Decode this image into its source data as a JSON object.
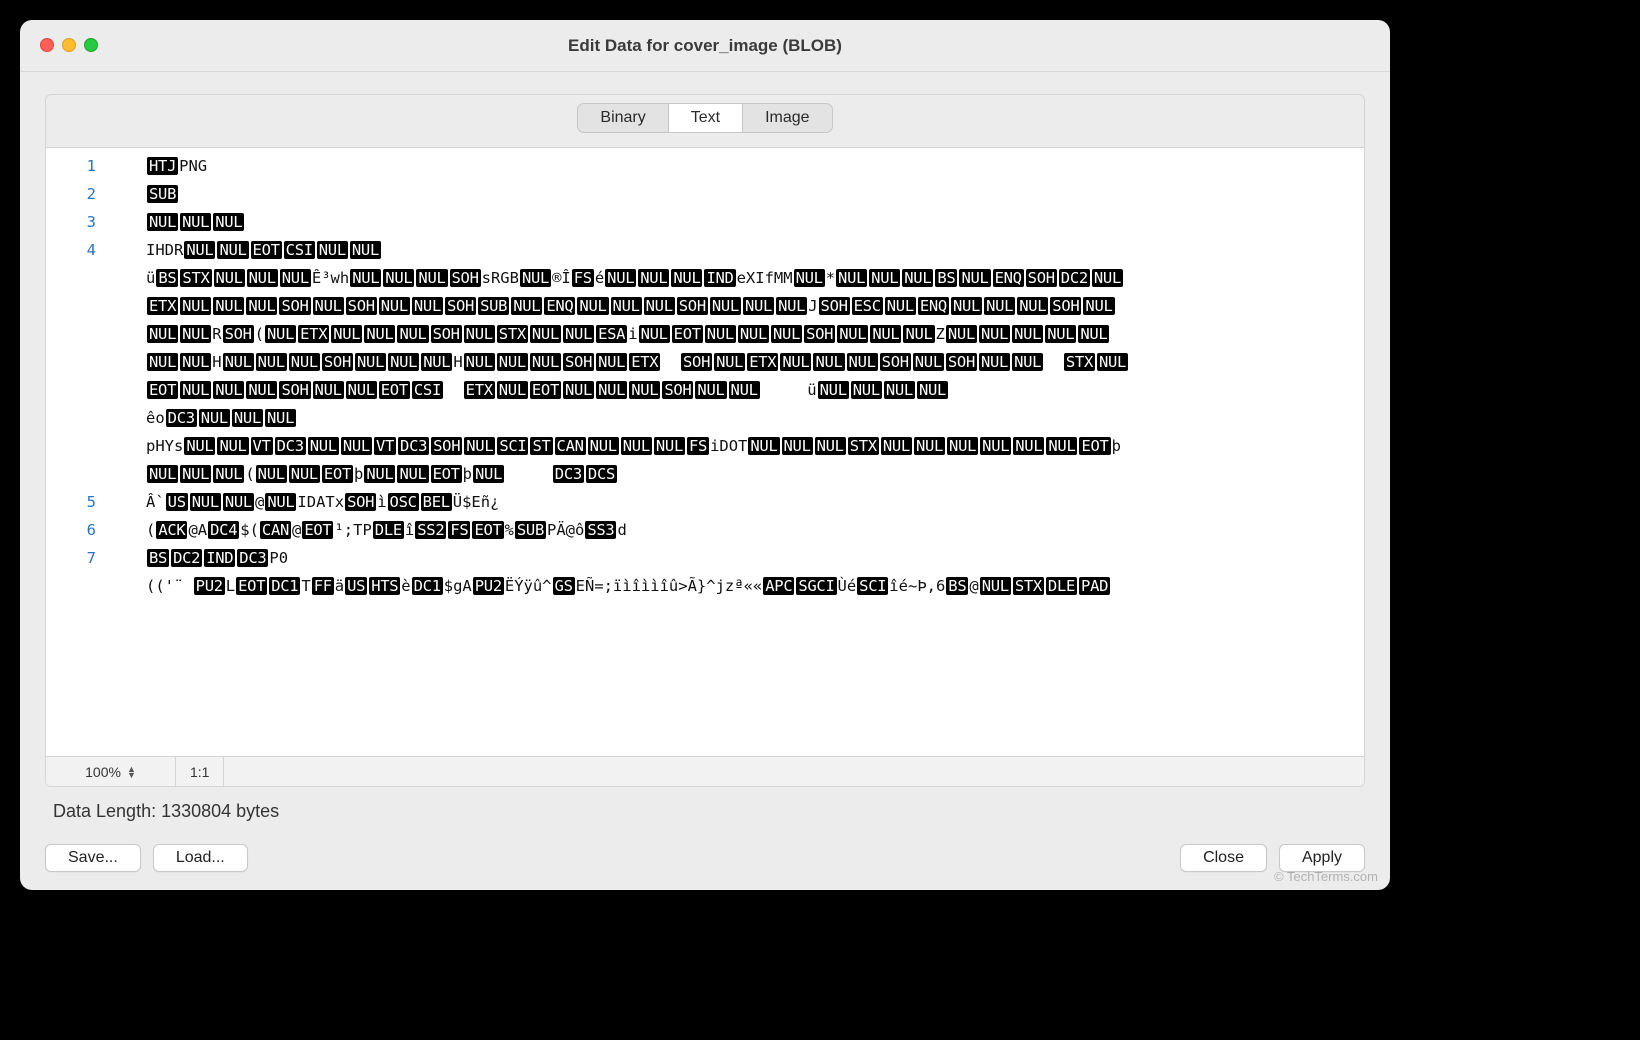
{
  "title": "Edit Data for cover_image (BLOB)",
  "tabs": {
    "binary": "Binary",
    "text": "Text",
    "image": "Image",
    "active": "text"
  },
  "status": {
    "zoom": "100%",
    "pos": "1:1"
  },
  "data_length_label": "Data Length: 1330804 bytes",
  "buttons": {
    "save": "Save...",
    "load": "Load...",
    "close": "Close",
    "apply": "Apply"
  },
  "watermark": "© TechTerms.com",
  "lines": [
    {
      "n": "1",
      "tokens": [
        {
          "t": "cc",
          "v": "HTJ"
        },
        {
          "t": "tx",
          "v": "PNG"
        }
      ]
    },
    {
      "n": "2",
      "tokens": [
        {
          "t": "cc",
          "v": "SUB"
        }
      ]
    },
    {
      "n": "3",
      "tokens": [
        {
          "t": "cc",
          "v": "NUL"
        },
        {
          "t": "cc",
          "v": "NUL"
        },
        {
          "t": "cc",
          "v": "NUL"
        }
      ]
    },
    {
      "n": "4",
      "tokens": [
        {
          "t": "tx",
          "v": "IHDR"
        },
        {
          "t": "cc",
          "v": "NUL"
        },
        {
          "t": "cc",
          "v": "NUL"
        },
        {
          "t": "cc",
          "v": "EOT"
        },
        {
          "t": "cc",
          "v": "CSI"
        },
        {
          "t": "cc",
          "v": "NUL"
        },
        {
          "t": "cc",
          "v": "NUL"
        }
      ]
    },
    {
      "n": "",
      "tokens": [
        {
          "t": "tx",
          "v": "ü"
        },
        {
          "t": "cc",
          "v": "BS"
        },
        {
          "t": "cc",
          "v": "STX"
        },
        {
          "t": "cc",
          "v": "NUL"
        },
        {
          "t": "cc",
          "v": "NUL"
        },
        {
          "t": "cc",
          "v": "NUL"
        },
        {
          "t": "tx",
          "v": "Ê³wh"
        },
        {
          "t": "cc",
          "v": "NUL"
        },
        {
          "t": "cc",
          "v": "NUL"
        },
        {
          "t": "cc",
          "v": "NUL"
        },
        {
          "t": "cc",
          "v": "SOH"
        },
        {
          "t": "tx",
          "v": "sRGB"
        },
        {
          "t": "cc",
          "v": "NUL"
        },
        {
          "t": "tx",
          "v": "®Î"
        },
        {
          "t": "cc",
          "v": "FS"
        },
        {
          "t": "tx",
          "v": "é"
        },
        {
          "t": "cc",
          "v": "NUL"
        },
        {
          "t": "cc",
          "v": "NUL"
        },
        {
          "t": "cc",
          "v": "NUL"
        },
        {
          "t": "cc",
          "v": "IND"
        },
        {
          "t": "tx",
          "v": "eXIfMM"
        },
        {
          "t": "cc",
          "v": "NUL"
        },
        {
          "t": "tx",
          "v": "*"
        },
        {
          "t": "cc",
          "v": "NUL"
        },
        {
          "t": "cc",
          "v": "NUL"
        },
        {
          "t": "cc",
          "v": "NUL"
        },
        {
          "t": "cc",
          "v": "BS"
        },
        {
          "t": "cc",
          "v": "NUL"
        },
        {
          "t": "cc",
          "v": "ENQ"
        },
        {
          "t": "cc",
          "v": "SOH"
        },
        {
          "t": "cc",
          "v": "DC2"
        },
        {
          "t": "cc",
          "v": "NUL"
        }
      ]
    },
    {
      "n": "",
      "tokens": [
        {
          "t": "cc",
          "v": "ETX"
        },
        {
          "t": "cc",
          "v": "NUL"
        },
        {
          "t": "cc",
          "v": "NUL"
        },
        {
          "t": "cc",
          "v": "NUL"
        },
        {
          "t": "cc",
          "v": "SOH"
        },
        {
          "t": "cc",
          "v": "NUL"
        },
        {
          "t": "cc",
          "v": "SOH"
        },
        {
          "t": "cc",
          "v": "NUL"
        },
        {
          "t": "cc",
          "v": "NUL"
        },
        {
          "t": "cc",
          "v": "SOH"
        },
        {
          "t": "cc",
          "v": "SUB"
        },
        {
          "t": "cc",
          "v": "NUL"
        },
        {
          "t": "cc",
          "v": "ENQ"
        },
        {
          "t": "cc",
          "v": "NUL"
        },
        {
          "t": "cc",
          "v": "NUL"
        },
        {
          "t": "cc",
          "v": "NUL"
        },
        {
          "t": "cc",
          "v": "SOH"
        },
        {
          "t": "cc",
          "v": "NUL"
        },
        {
          "t": "cc",
          "v": "NUL"
        },
        {
          "t": "cc",
          "v": "NUL"
        },
        {
          "t": "tx",
          "v": "J"
        },
        {
          "t": "cc",
          "v": "SOH"
        },
        {
          "t": "cc",
          "v": "ESC"
        },
        {
          "t": "cc",
          "v": "NUL"
        },
        {
          "t": "cc",
          "v": "ENQ"
        },
        {
          "t": "cc",
          "v": "NUL"
        },
        {
          "t": "cc",
          "v": "NUL"
        },
        {
          "t": "cc",
          "v": "NUL"
        },
        {
          "t": "cc",
          "v": "SOH"
        },
        {
          "t": "cc",
          "v": "NUL"
        }
      ]
    },
    {
      "n": "",
      "tokens": [
        {
          "t": "cc",
          "v": "NUL"
        },
        {
          "t": "cc",
          "v": "NUL"
        },
        {
          "t": "tx",
          "v": "R"
        },
        {
          "t": "cc",
          "v": "SOH"
        },
        {
          "t": "tx",
          "v": "("
        },
        {
          "t": "cc",
          "v": "NUL"
        },
        {
          "t": "cc",
          "v": "ETX"
        },
        {
          "t": "cc",
          "v": "NUL"
        },
        {
          "t": "cc",
          "v": "NUL"
        },
        {
          "t": "cc",
          "v": "NUL"
        },
        {
          "t": "cc",
          "v": "SOH"
        },
        {
          "t": "cc",
          "v": "NUL"
        },
        {
          "t": "cc",
          "v": "STX"
        },
        {
          "t": "cc",
          "v": "NUL"
        },
        {
          "t": "cc",
          "v": "NUL"
        },
        {
          "t": "cc",
          "v": "ESA"
        },
        {
          "t": "tx",
          "v": "i"
        },
        {
          "t": "cc",
          "v": "NUL"
        },
        {
          "t": "cc",
          "v": "EOT"
        },
        {
          "t": "cc",
          "v": "NUL"
        },
        {
          "t": "cc",
          "v": "NUL"
        },
        {
          "t": "cc",
          "v": "NUL"
        },
        {
          "t": "cc",
          "v": "SOH"
        },
        {
          "t": "cc",
          "v": "NUL"
        },
        {
          "t": "cc",
          "v": "NUL"
        },
        {
          "t": "cc",
          "v": "NUL"
        },
        {
          "t": "tx",
          "v": "Z"
        },
        {
          "t": "cc",
          "v": "NUL"
        },
        {
          "t": "cc",
          "v": "NUL"
        },
        {
          "t": "cc",
          "v": "NUL"
        },
        {
          "t": "cc",
          "v": "NUL"
        },
        {
          "t": "cc",
          "v": "NUL"
        }
      ]
    },
    {
      "n": "",
      "tokens": [
        {
          "t": "cc",
          "v": "NUL"
        },
        {
          "t": "cc",
          "v": "NUL"
        },
        {
          "t": "tx",
          "v": "H"
        },
        {
          "t": "cc",
          "v": "NUL"
        },
        {
          "t": "cc",
          "v": "NUL"
        },
        {
          "t": "cc",
          "v": "NUL"
        },
        {
          "t": "cc",
          "v": "SOH"
        },
        {
          "t": "cc",
          "v": "NUL"
        },
        {
          "t": "cc",
          "v": "NUL"
        },
        {
          "t": "cc",
          "v": "NUL"
        },
        {
          "t": "tx",
          "v": "H"
        },
        {
          "t": "cc",
          "v": "NUL"
        },
        {
          "t": "cc",
          "v": "NUL"
        },
        {
          "t": "cc",
          "v": "NUL"
        },
        {
          "t": "cc",
          "v": "SOH"
        },
        {
          "t": "cc",
          "v": "NUL"
        },
        {
          "t": "cc",
          "v": "ETX"
        },
        {
          "t": "tx",
          "v": "  "
        },
        {
          "t": "cc",
          "v": "SOH"
        },
        {
          "t": "cc",
          "v": "NUL"
        },
        {
          "t": "cc",
          "v": "ETX"
        },
        {
          "t": "cc",
          "v": "NUL"
        },
        {
          "t": "cc",
          "v": "NUL"
        },
        {
          "t": "cc",
          "v": "NUL"
        },
        {
          "t": "cc",
          "v": "SOH"
        },
        {
          "t": "cc",
          "v": "NUL"
        },
        {
          "t": "cc",
          "v": "SOH"
        },
        {
          "t": "cc",
          "v": "NUL"
        },
        {
          "t": "cc",
          "v": "NUL"
        },
        {
          "t": "tx",
          "v": "  "
        },
        {
          "t": "cc",
          "v": "STX"
        },
        {
          "t": "cc",
          "v": "NUL"
        }
      ]
    },
    {
      "n": "",
      "tokens": [
        {
          "t": "cc",
          "v": "EOT"
        },
        {
          "t": "cc",
          "v": "NUL"
        },
        {
          "t": "cc",
          "v": "NUL"
        },
        {
          "t": "cc",
          "v": "NUL"
        },
        {
          "t": "cc",
          "v": "SOH"
        },
        {
          "t": "cc",
          "v": "NUL"
        },
        {
          "t": "cc",
          "v": "NUL"
        },
        {
          "t": "cc",
          "v": "EOT"
        },
        {
          "t": "cc",
          "v": "CSI"
        },
        {
          "t": "tx",
          "v": "  "
        },
        {
          "t": "cc",
          "v": "ETX"
        },
        {
          "t": "cc",
          "v": "NUL"
        },
        {
          "t": "cc",
          "v": "EOT"
        },
        {
          "t": "cc",
          "v": "NUL"
        },
        {
          "t": "cc",
          "v": "NUL"
        },
        {
          "t": "cc",
          "v": "NUL"
        },
        {
          "t": "cc",
          "v": "SOH"
        },
        {
          "t": "cc",
          "v": "NUL"
        },
        {
          "t": "cc",
          "v": "NUL"
        },
        {
          "t": "tx",
          "v": "     ü"
        },
        {
          "t": "cc",
          "v": "NUL"
        },
        {
          "t": "cc",
          "v": "NUL"
        },
        {
          "t": "cc",
          "v": "NUL"
        },
        {
          "t": "cc",
          "v": "NUL"
        }
      ]
    },
    {
      "n": "",
      "tokens": [
        {
          "t": "tx",
          "v": "êo"
        },
        {
          "t": "cc",
          "v": "DC3"
        },
        {
          "t": "cc",
          "v": "NUL"
        },
        {
          "t": "cc",
          "v": "NUL"
        },
        {
          "t": "cc",
          "v": "NUL"
        }
      ]
    },
    {
      "n": "",
      "tokens": [
        {
          "t": "tx",
          "v": "pHYs"
        },
        {
          "t": "cc",
          "v": "NUL"
        },
        {
          "t": "cc",
          "v": "NUL"
        },
        {
          "t": "cc",
          "v": "VT"
        },
        {
          "t": "cc",
          "v": "DC3"
        },
        {
          "t": "cc",
          "v": "NUL"
        },
        {
          "t": "cc",
          "v": "NUL"
        },
        {
          "t": "cc",
          "v": "VT"
        },
        {
          "t": "cc",
          "v": "DC3"
        },
        {
          "t": "cc",
          "v": "SOH"
        },
        {
          "t": "cc",
          "v": "NUL"
        },
        {
          "t": "cc",
          "v": "SCI"
        },
        {
          "t": "cc",
          "v": "ST"
        },
        {
          "t": "cc",
          "v": "CAN"
        },
        {
          "t": "cc",
          "v": "NUL"
        },
        {
          "t": "cc",
          "v": "NUL"
        },
        {
          "t": "cc",
          "v": "NUL"
        },
        {
          "t": "cc",
          "v": "FS"
        },
        {
          "t": "tx",
          "v": "iDOT"
        },
        {
          "t": "cc",
          "v": "NUL"
        },
        {
          "t": "cc",
          "v": "NUL"
        },
        {
          "t": "cc",
          "v": "NUL"
        },
        {
          "t": "cc",
          "v": "STX"
        },
        {
          "t": "cc",
          "v": "NUL"
        },
        {
          "t": "cc",
          "v": "NUL"
        },
        {
          "t": "cc",
          "v": "NUL"
        },
        {
          "t": "cc",
          "v": "NUL"
        },
        {
          "t": "cc",
          "v": "NUL"
        },
        {
          "t": "cc",
          "v": "NUL"
        },
        {
          "t": "cc",
          "v": "EOT"
        },
        {
          "t": "tx",
          "v": "þ"
        }
      ]
    },
    {
      "n": "",
      "tokens": [
        {
          "t": "cc",
          "v": "NUL"
        },
        {
          "t": "cc",
          "v": "NUL"
        },
        {
          "t": "cc",
          "v": "NUL"
        },
        {
          "t": "tx",
          "v": "("
        },
        {
          "t": "cc",
          "v": "NUL"
        },
        {
          "t": "cc",
          "v": "NUL"
        },
        {
          "t": "cc",
          "v": "EOT"
        },
        {
          "t": "tx",
          "v": "þ"
        },
        {
          "t": "cc",
          "v": "NUL"
        },
        {
          "t": "cc",
          "v": "NUL"
        },
        {
          "t": "cc",
          "v": "EOT"
        },
        {
          "t": "tx",
          "v": "þ"
        },
        {
          "t": "cc",
          "v": "NUL"
        },
        {
          "t": "tx",
          "v": "     "
        },
        {
          "t": "cc",
          "v": "DC3"
        },
        {
          "t": "cc",
          "v": "DCS"
        }
      ]
    },
    {
      "n": "5",
      "tokens": [
        {
          "t": "tx",
          "v": "Â`"
        },
        {
          "t": "cc",
          "v": "US"
        },
        {
          "t": "cc",
          "v": "NUL"
        },
        {
          "t": "cc",
          "v": "NUL"
        },
        {
          "t": "tx",
          "v": "@"
        },
        {
          "t": "cc",
          "v": "NUL"
        },
        {
          "t": "tx",
          "v": "IDATx"
        },
        {
          "t": "cc",
          "v": "SOH"
        },
        {
          "t": "tx",
          "v": "ì"
        },
        {
          "t": "cc",
          "v": "OSC"
        },
        {
          "t": "cc",
          "v": "BEL"
        },
        {
          "t": "tx",
          "v": "Ü$Eñ¿"
        }
      ]
    },
    {
      "n": "6",
      "tokens": [
        {
          "t": "tx",
          "v": "("
        },
        {
          "t": "cc",
          "v": "ACK"
        },
        {
          "t": "tx",
          "v": "@A"
        },
        {
          "t": "cc",
          "v": "DC4"
        },
        {
          "t": "tx",
          "v": "$("
        },
        {
          "t": "cc",
          "v": "CAN"
        },
        {
          "t": "tx",
          "v": "@"
        },
        {
          "t": "cc",
          "v": "EOT"
        },
        {
          "t": "tx",
          "v": "¹;TP"
        },
        {
          "t": "cc",
          "v": "DLE"
        },
        {
          "t": "tx",
          "v": "î"
        },
        {
          "t": "cc",
          "v": "SS2"
        },
        {
          "t": "cc",
          "v": "FS"
        },
        {
          "t": "cc",
          "v": "EOT"
        },
        {
          "t": "tx",
          "v": "%"
        },
        {
          "t": "cc",
          "v": "SUB"
        },
        {
          "t": "tx",
          "v": "PÄ@ô"
        },
        {
          "t": "cc",
          "v": "SS3"
        },
        {
          "t": "tx",
          "v": "d"
        }
      ]
    },
    {
      "n": "7",
      "tokens": [
        {
          "t": "cc",
          "v": "BS"
        },
        {
          "t": "cc",
          "v": "DC2"
        },
        {
          "t": "cc",
          "v": "IND"
        },
        {
          "t": "cc",
          "v": "DC3"
        },
        {
          "t": "tx",
          "v": "P0"
        }
      ]
    },
    {
      "n": "",
      "tokens": [
        {
          "t": "tx",
          "v": "(('¨ "
        },
        {
          "t": "cc",
          "v": "PU2"
        },
        {
          "t": "tx",
          "v": "L"
        },
        {
          "t": "cc",
          "v": "EOT"
        },
        {
          "t": "cc",
          "v": "DC1"
        },
        {
          "t": "tx",
          "v": "T"
        },
        {
          "t": "cc",
          "v": "FF"
        },
        {
          "t": "tx",
          "v": "ä"
        },
        {
          "t": "cc",
          "v": "US"
        },
        {
          "t": "cc",
          "v": "HTS"
        },
        {
          "t": "tx",
          "v": "è"
        },
        {
          "t": "cc",
          "v": "DC1"
        },
        {
          "t": "tx",
          "v": "$gA"
        },
        {
          "t": "cc",
          "v": "PU2"
        },
        {
          "t": "tx",
          "v": "ËÝÿû^"
        },
        {
          "t": "cc",
          "v": "GS"
        },
        {
          "t": "tx",
          "v": "EÑ=;ïìîììîû>Ã}^jzª««"
        },
        {
          "t": "cc",
          "v": "APC"
        },
        {
          "t": "cc",
          "v": "SGCI"
        },
        {
          "t": "tx",
          "v": "Ùé"
        },
        {
          "t": "cc",
          "v": "SCI"
        },
        {
          "t": "tx",
          "v": "îé~Þ,6"
        },
        {
          "t": "cc",
          "v": "BS"
        },
        {
          "t": "tx",
          "v": "@"
        },
        {
          "t": "cc",
          "v": "NUL"
        },
        {
          "t": "cc",
          "v": "STX"
        },
        {
          "t": "cc",
          "v": "DLE"
        },
        {
          "t": "cc",
          "v": "PAD"
        }
      ]
    }
  ]
}
